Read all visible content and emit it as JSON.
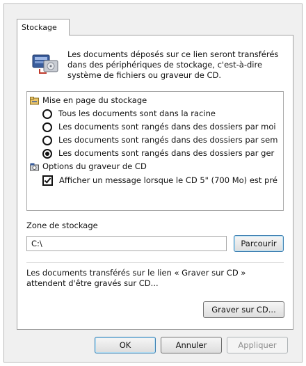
{
  "tab": {
    "label": "Stockage"
  },
  "description": "Les documents déposés sur ce lien seront transférés dans des périphériques de stockage, c'est-à-dire système de fichiers ou graveur de CD.",
  "layout_section": {
    "title": "Mise en page du stockage",
    "options": [
      {
        "label": "Tous les documents sont dans la racine",
        "selected": false
      },
      {
        "label": "Les documents sont rangés dans des dossiers par moi",
        "selected": false
      },
      {
        "label": "Les documents sont rangés dans des dossiers par sem",
        "selected": false
      },
      {
        "label": "Les documents sont rangés dans des dossiers par ger",
        "selected": true
      }
    ]
  },
  "cd_section": {
    "title": "Options du graveur de CD",
    "checkbox_label": "Afficher un message lorsque le CD 5\" (700 Mo) est pré",
    "checked": true
  },
  "storage_zone": {
    "label": "Zone de stockage",
    "path": "C:\\",
    "browse_label": "Parcourir"
  },
  "burn_note": "Les documents transférés sur le lien « Graver sur CD » attendent d'être gravés sur CD...",
  "burn_button": "Graver sur CD...",
  "footer": {
    "ok": "OK",
    "cancel": "Annuler",
    "apply": "Appliquer"
  }
}
